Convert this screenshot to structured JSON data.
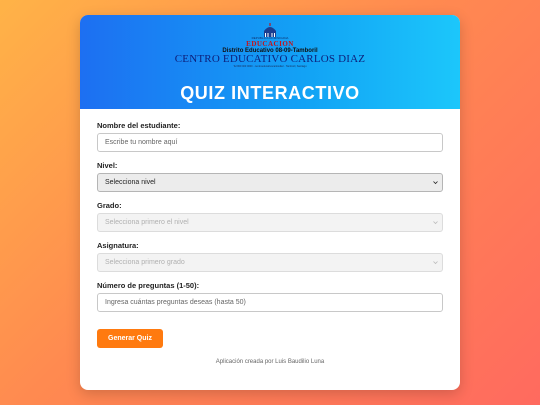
{
  "header": {
    "seal_small_text": "REPUBLICA DOMINICANA",
    "edu_word": "EDUCACION",
    "district": "Distrito Educativo 08-09-Tamboril",
    "school": "CENTRO EDUCATIVO CARLOS DIAZ",
    "contact": "Tel 809 000 0000 · centroeducativocarlosdiaz · Tamboril, Santiago",
    "title": "QUIZ INTERACTIVO"
  },
  "form": {
    "student_label": "Nombre del estudiante:",
    "student_placeholder": "Escribe tu nombre aquí",
    "level_label": "Nivel:",
    "level_value": "Selecciona nivel",
    "grade_label": "Grado:",
    "grade_value": "Selecciona primero el nivel",
    "subject_label": "Asignatura:",
    "subject_value": "Selecciona primero grado",
    "count_label": "Número de preguntas (1-50):",
    "count_placeholder": "Ingresa cuántas preguntas deseas (hasta 50)",
    "submit_label": "Generar Quiz"
  },
  "footer": {
    "credit": "Aplicación creada por Luis Baudilio Luna"
  },
  "colors": {
    "accent": "#ff7a0f",
    "header_start": "#1d6ff2",
    "header_end": "#1cc7fb"
  },
  "icons": [
    "seal-icon",
    "chevron-down-icon"
  ]
}
